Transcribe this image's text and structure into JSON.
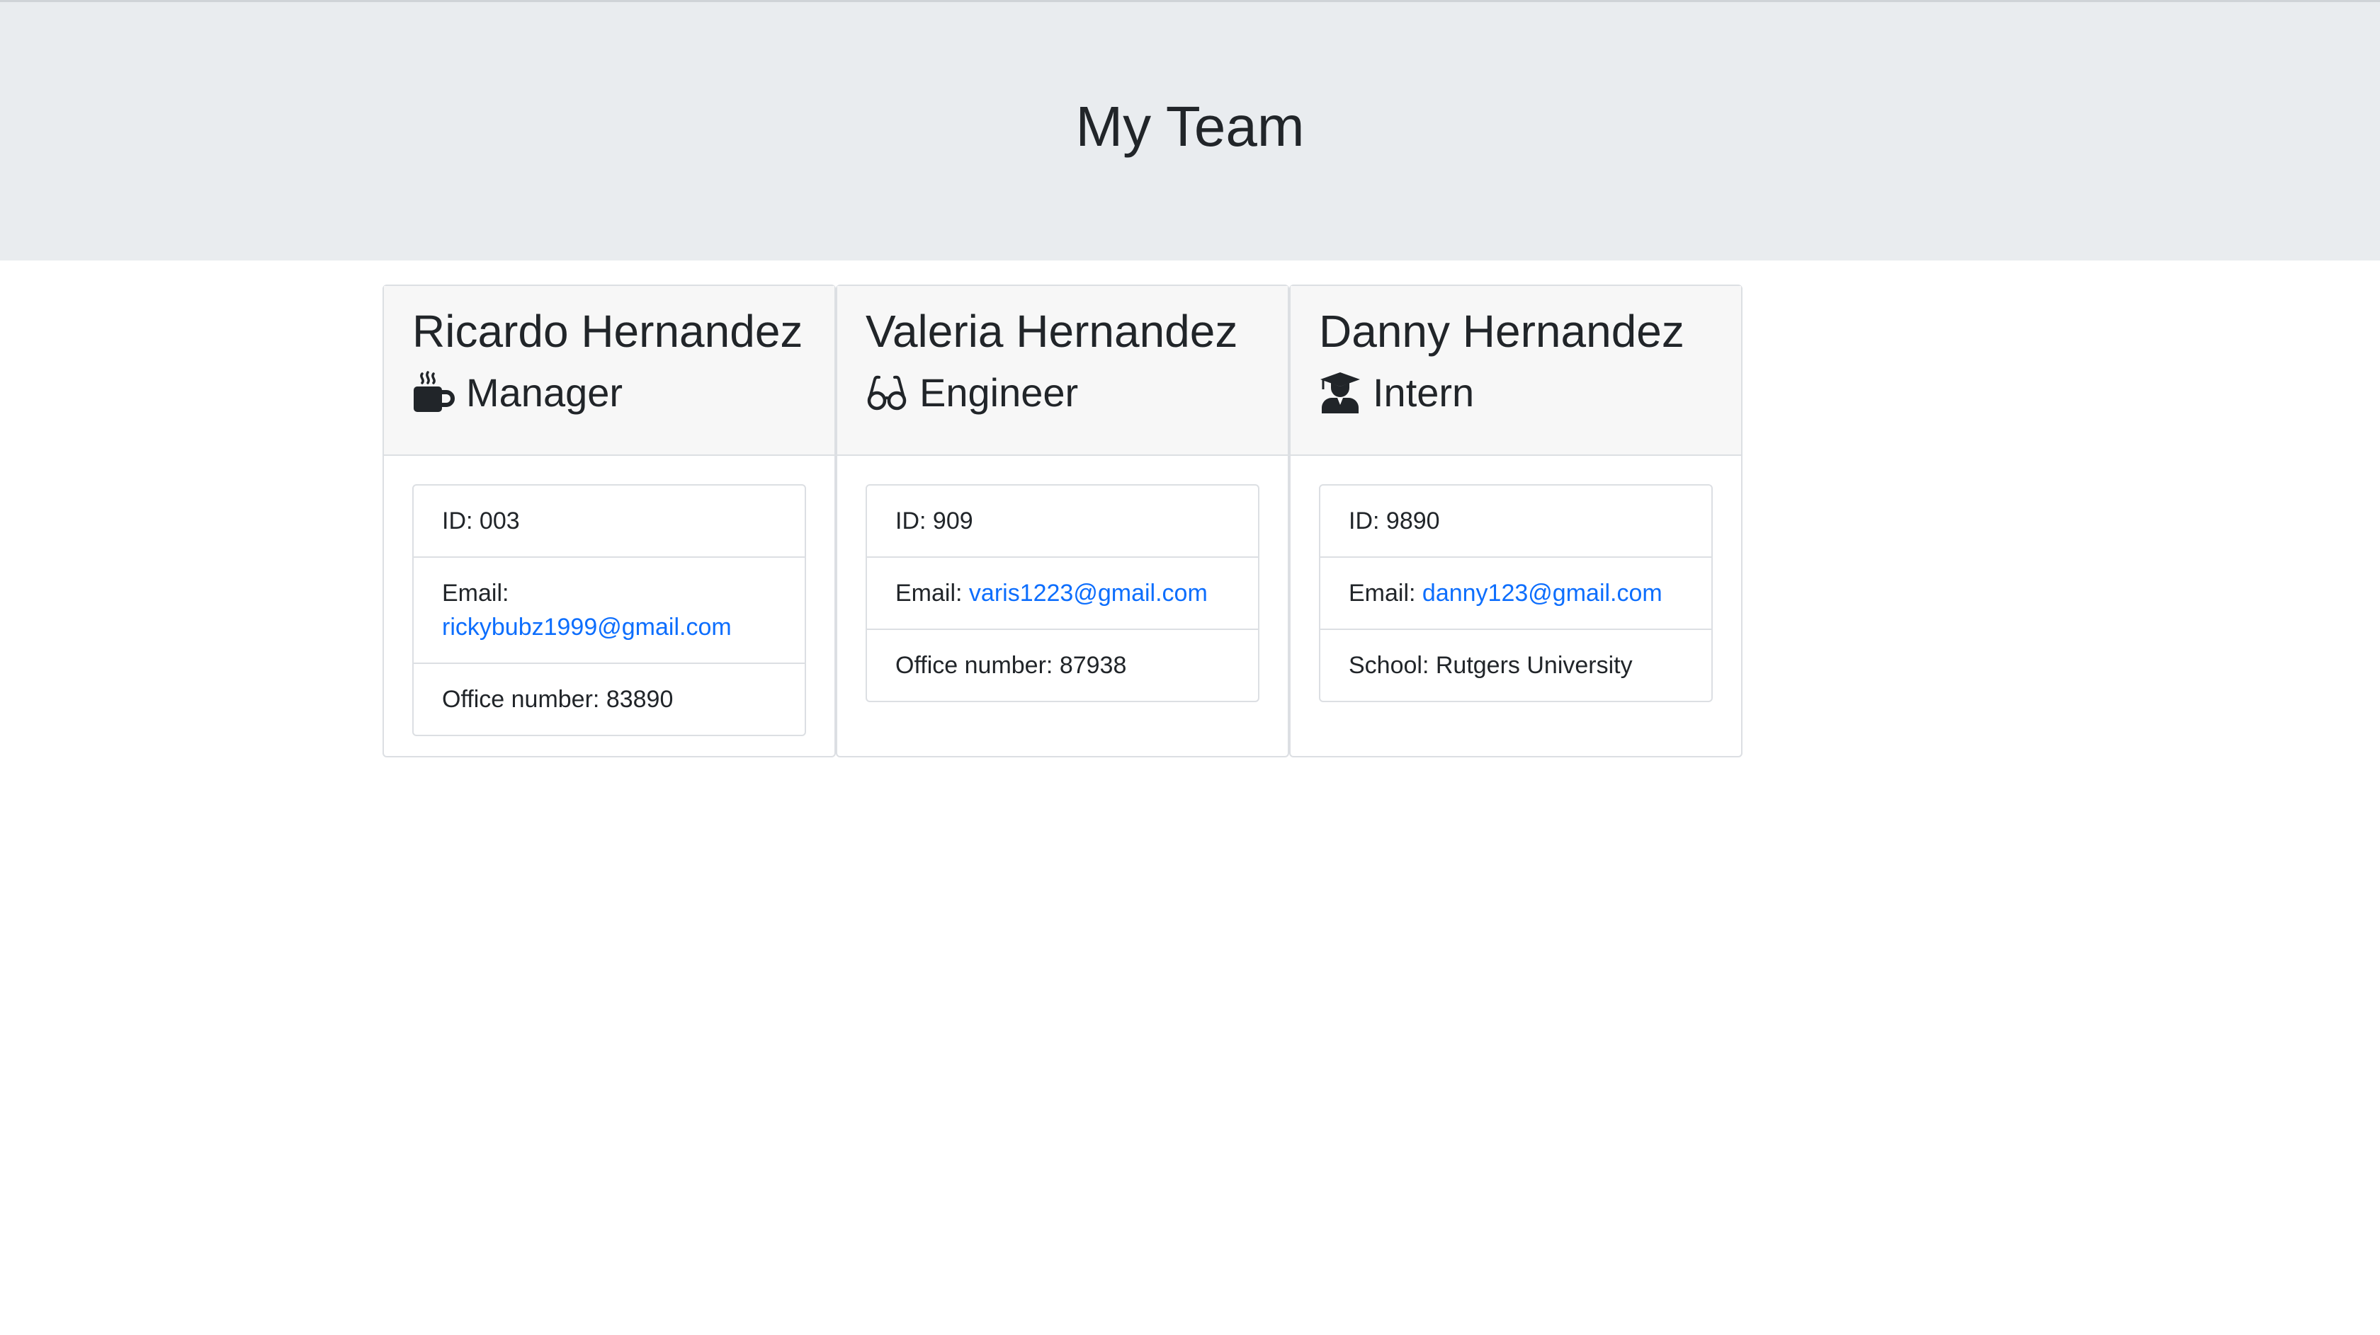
{
  "header": {
    "title": "My Team"
  },
  "employees": [
    {
      "name": "Ricardo Hernandez",
      "role": "Manager",
      "icon": "coffee-mug-icon",
      "id_label": "ID: ",
      "id": "003",
      "email_label": "Email: ",
      "email": "rickybubz1999@gmail.com",
      "extra_label": "Office number: ",
      "extra": "83890"
    },
    {
      "name": "Valeria Hernandez",
      "role": "Engineer",
      "icon": "glasses-icon",
      "id_label": "ID: ",
      "id": "909",
      "email_label": "Email: ",
      "email": "varis1223@gmail.com",
      "extra_label": "Office number: ",
      "extra": "87938"
    },
    {
      "name": "Danny Hernandez",
      "role": "Intern",
      "icon": "graduate-icon",
      "id_label": "ID: ",
      "id": "9890",
      "email_label": "Email: ",
      "email": "danny123@gmail.com",
      "extra_label": "School: ",
      "extra": "Rutgers University"
    }
  ],
  "colors": {
    "header_bg": "#e9ecef",
    "link": "#0d6efd",
    "text": "#212529"
  }
}
